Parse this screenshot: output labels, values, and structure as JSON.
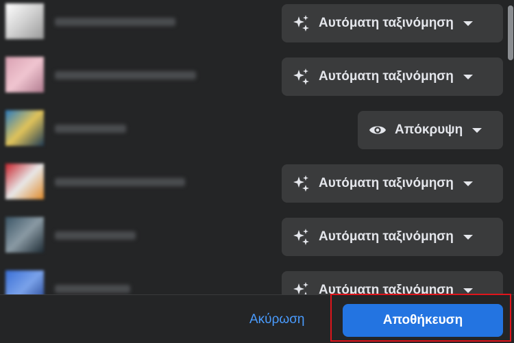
{
  "rows": [
    {
      "option": "Αυτόματη ταξινόμηση",
      "icon": "sparkles-icon",
      "avatar_colors": [
        "#ffffff",
        "#d0d0d0",
        "#9a9a9a"
      ]
    },
    {
      "option": "Αυτόματη ταξινόμηση",
      "icon": "sparkles-icon",
      "avatar_colors": [
        "#d9a1b2",
        "#f0c5d0",
        "#b07b8f"
      ]
    },
    {
      "option": "Απόκρυψη",
      "icon": "eye-icon",
      "avatar_colors": [
        "#2a7bbf",
        "#e0c35a",
        "#1e3a55"
      ]
    },
    {
      "option": "Αυτόματη ταξινόμηση",
      "icon": "sparkles-icon",
      "avatar_colors": [
        "#c8232c",
        "#e8e8e8",
        "#e08a2a"
      ]
    },
    {
      "option": "Αυτόματη ταξινόμηση",
      "icon": "sparkles-icon",
      "avatar_colors": [
        "#3b5566",
        "#8a9aa4",
        "#1d2a33"
      ]
    },
    {
      "option": "Αυτόματη ταξινόμηση",
      "icon": "sparkles-icon",
      "avatar_colors": [
        "#3a6fd6",
        "#7aa2ea",
        "#1c3c8a"
      ]
    }
  ],
  "footer": {
    "cancel_label": "Ακύρωση",
    "save_label": "Αποθήκευση"
  },
  "colors": {
    "background": "#242526",
    "button_bg": "#3a3b3c",
    "primary": "#2374e1",
    "link": "#4a9cff",
    "highlight": "#e0151b"
  }
}
